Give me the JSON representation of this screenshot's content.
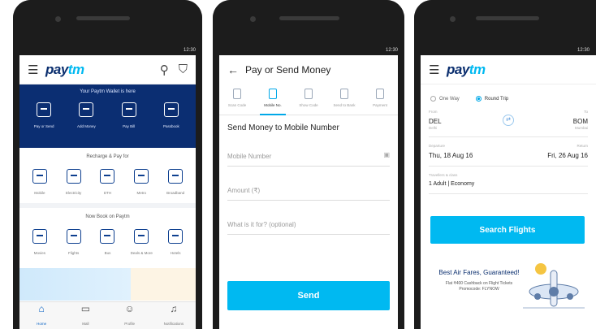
{
  "status_time": "12:30",
  "screen1": {
    "logo_pay": "pay",
    "logo_tm": "tm",
    "band_title": "Your Paytm Wallet is here",
    "wallet_items": [
      "Pay or Send",
      "Add Money",
      "Pay Bill",
      "Passbook"
    ],
    "recharge_title": "Recharge & Pay for",
    "recharge_items": [
      "Mobile",
      "Electricity",
      "DTH",
      "Metro",
      "Broadband"
    ],
    "book_title": "Now Book on Paytm",
    "book_items": [
      "Movies",
      "Flights",
      "Bus",
      "Deals & More",
      "Hotels"
    ],
    "nav": [
      "Home",
      "Mall",
      "Profile",
      "Notifications"
    ]
  },
  "screen2": {
    "title": "Pay or Send Money",
    "tabs": [
      "Scan Code",
      "Mobile No.",
      "Show Code",
      "Send to Bank",
      "Payment"
    ],
    "form_title": "Send Money to Mobile Number",
    "mobile_placeholder": "Mobile Number",
    "amount_placeholder": "Amount (₹)",
    "purpose_placeholder": "What is it for? (optional)",
    "send_label": "Send"
  },
  "screen3": {
    "logo_pay": "pay",
    "logo_tm": "tm",
    "one_way": "One Way",
    "round_trip": "Round Trip",
    "from_label": "From",
    "from_code": "DEL",
    "from_city": "Delhi",
    "to_label": "To",
    "to_code": "BOM",
    "to_city": "Mumbai",
    "depart_label": "Departure",
    "depart_date": "Thu, 18 Aug 16",
    "return_label": "Return",
    "return_date": "Fri, 26 Aug 16",
    "travellers_label": "Travellers & class",
    "travellers_value": "1 Adult | Economy",
    "search_label": "Search Flights",
    "ad_head": "Best Air Fares, Guaranteed!",
    "ad_sub": "Flat ₹400 Cashback on Flight Tickets Promocode: FLYNOW"
  },
  "colors": {
    "brand_dark": "#0b2e72",
    "brand_light": "#00b9f1"
  }
}
